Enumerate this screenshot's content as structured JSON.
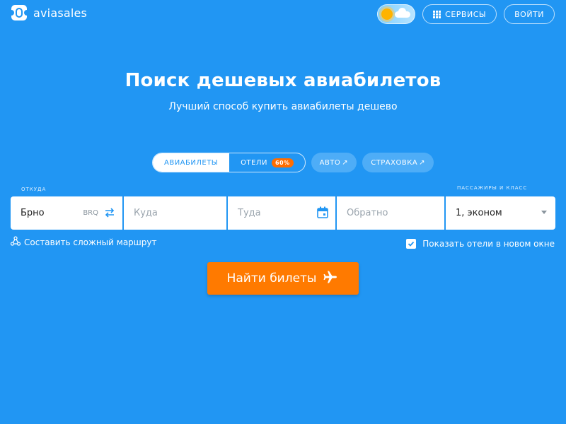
{
  "header": {
    "logo_text": "aviasales",
    "services_label": "СЕРВИСЫ",
    "login_label": "ВОЙТИ"
  },
  "hero": {
    "title": "Поиск дешевых авиабилетов",
    "subtitle": "Лучший способ купить авиабилеты дешево"
  },
  "tabs": {
    "flights": "АВИАБИЛЕТЫ",
    "hotels": "ОТЕЛИ",
    "hotels_badge": "60%",
    "auto": "АВТО",
    "insurance": "СТРАХОВКА"
  },
  "form": {
    "origin_label": "ОТКУДА",
    "pax_label": "ПАССАЖИРЫ И КЛАСС",
    "origin_value": "Брно",
    "origin_iata": "BRQ",
    "destination_placeholder": "Куда",
    "depart_placeholder": "Туда",
    "return_placeholder": "Обратно",
    "pax_value": "1, эконом"
  },
  "options": {
    "multi_route": "Составить сложный маршрут",
    "show_hotels": "Показать отели в новом окне",
    "show_hotels_checked": true
  },
  "search_button": "Найти билеты",
  "colors": {
    "background": "#2196f3",
    "accent": "#ff7a00",
    "badge": "#ff6d00"
  }
}
